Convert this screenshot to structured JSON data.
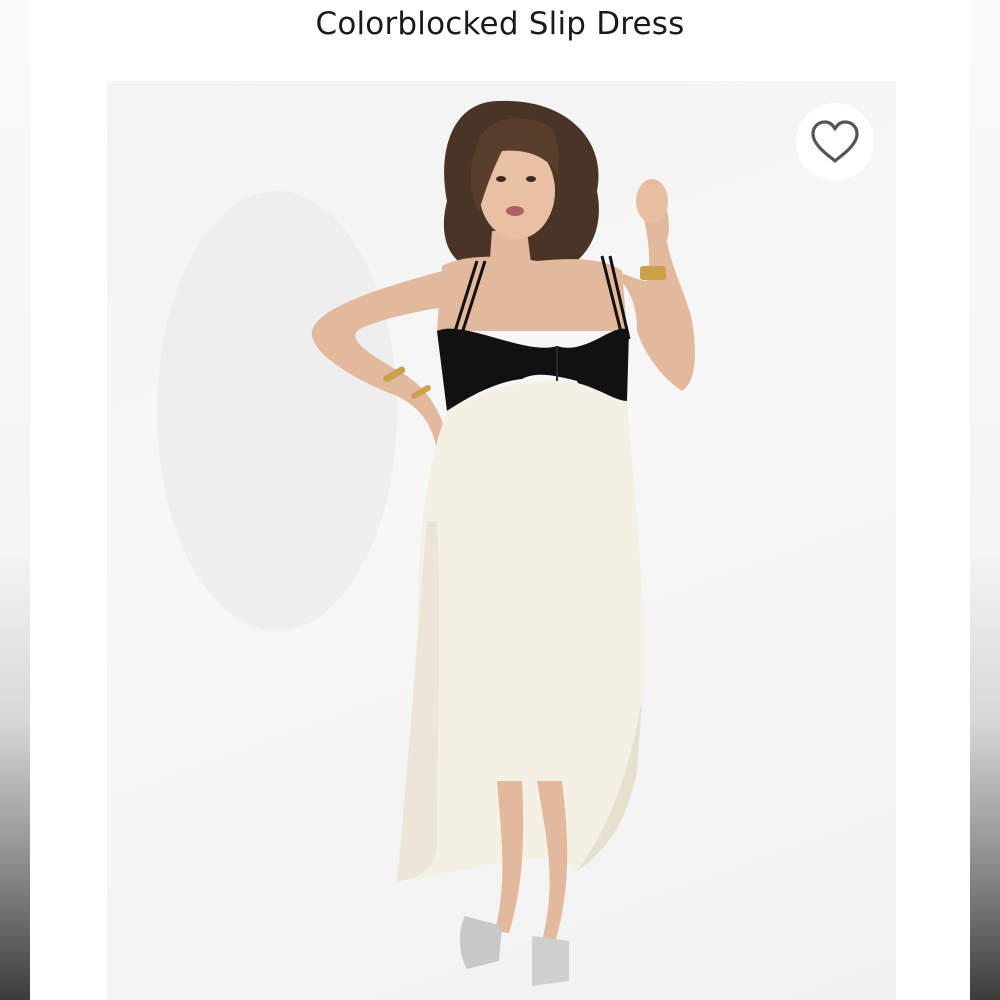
{
  "product": {
    "title": "Colorblocked Slip Dress"
  },
  "image": {
    "alt": "Model wearing a black and ivory colorblocked slip dress"
  },
  "favorite": {
    "icon": "heart-outline-icon",
    "color": "#555555"
  },
  "colors": {
    "bodice": "#111111",
    "skirt": "#f4f0e4",
    "background": "#f4f4f4"
  }
}
